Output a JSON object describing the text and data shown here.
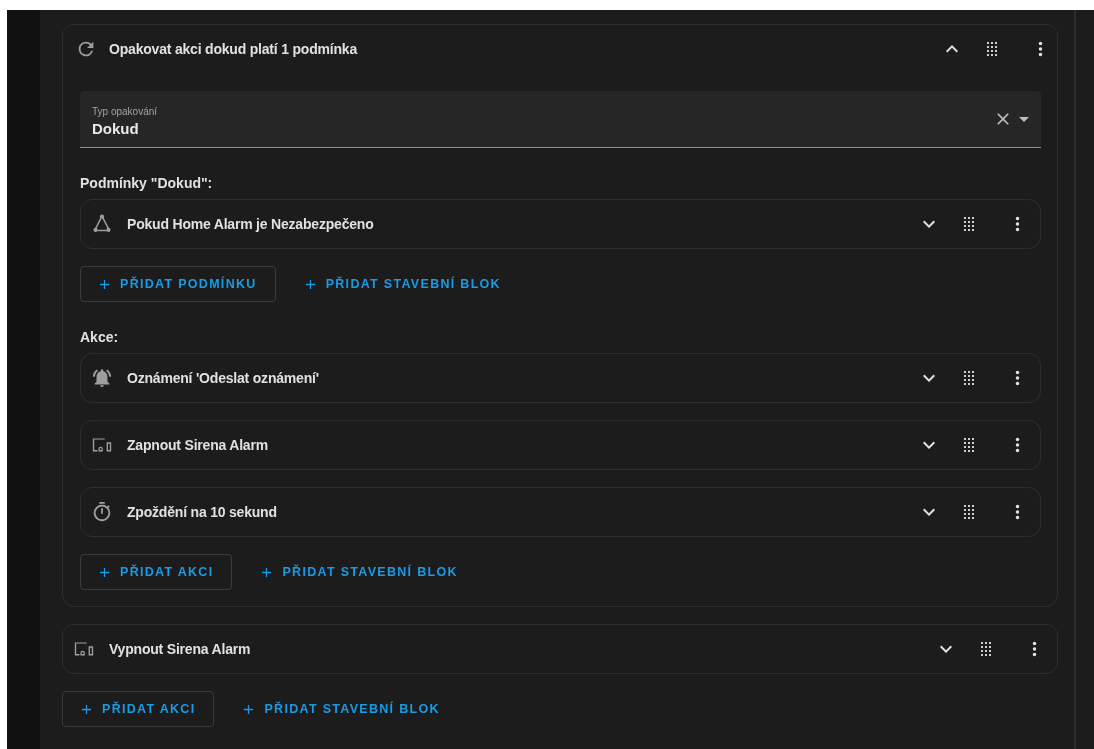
{
  "repeat_card": {
    "kind": "repeat",
    "title": "Opakovat akci dokud platí 1 podmínka",
    "expanded": true,
    "field": {
      "label": "Typ opakování",
      "value": "Dokud"
    },
    "sections": [
      {
        "heading": "Podmínky \"Dokud\":",
        "rows": [
          {
            "kind": "condition",
            "title": "Pokud Home Alarm je Nezabezpečeno",
            "expanded": false
          }
        ],
        "buttons": [
          {
            "kind": "outlined",
            "label": "PŘIDAT PODMÍNKU"
          },
          {
            "kind": "text",
            "label": "PŘIDAT STAVEBNÍ BLOK"
          }
        ]
      },
      {
        "heading": "Akce:",
        "rows": [
          {
            "kind": "notification",
            "title": "Oznámení 'Odeslat oznámení'",
            "expanded": false
          },
          {
            "kind": "device",
            "title": "Zapnout Sirena Alarm",
            "expanded": false
          },
          {
            "kind": "delay",
            "title": "Zpoždění na 10 sekund",
            "expanded": false
          }
        ],
        "buttons": [
          {
            "kind": "outlined",
            "label": "PŘIDAT AKCI"
          },
          {
            "kind": "text",
            "label": "PŘIDAT STAVEBNÍ BLOK"
          }
        ]
      }
    ]
  },
  "rows": [
    {
      "kind": "device",
      "title": "Vypnout Sirena Alarm",
      "expanded": false
    }
  ],
  "buttons": [
    {
      "kind": "outlined",
      "label": "PŘIDAT AKCI"
    },
    {
      "kind": "text",
      "label": "PŘIDAT STAVEBNÍ BLOK"
    }
  ]
}
